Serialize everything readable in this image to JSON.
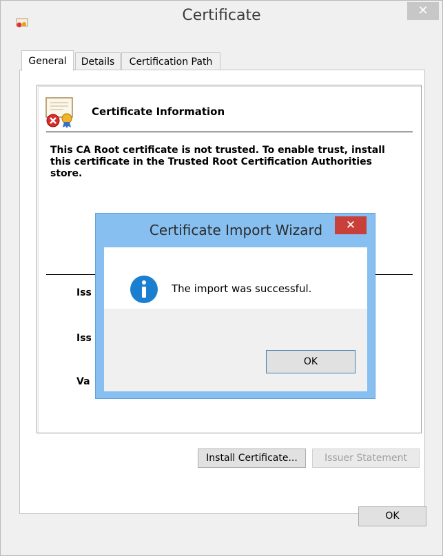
{
  "window": {
    "title": "Certificate",
    "close_symbol": "✕",
    "icon": "certificate-small-icon"
  },
  "tabs": [
    {
      "label": "General",
      "active": true
    },
    {
      "label": "Details",
      "active": false
    },
    {
      "label": "Certification Path",
      "active": false
    }
  ],
  "general": {
    "heading": "Certificate Information",
    "warning": "This CA Root certificate is not trusted. To enable trust, install this certificate in the Trusted Root Certification Authorities store.",
    "fields": [
      {
        "label": "Iss"
      },
      {
        "label": "Iss"
      },
      {
        "label": "Va"
      }
    ],
    "install_button": "Install Certificate...",
    "issuer_statement_button": "Issuer Statement"
  },
  "footer": {
    "ok_label": "OK"
  },
  "modal": {
    "title": "Certificate Import Wizard",
    "close_symbol": "✕",
    "message": "The import was successful.",
    "ok_label": "OK"
  },
  "colors": {
    "modal_frame": "#86bff0",
    "modal_close": "#c9403a",
    "info_icon": "#1a7fd1",
    "window_bg": "#f0f0f0"
  }
}
